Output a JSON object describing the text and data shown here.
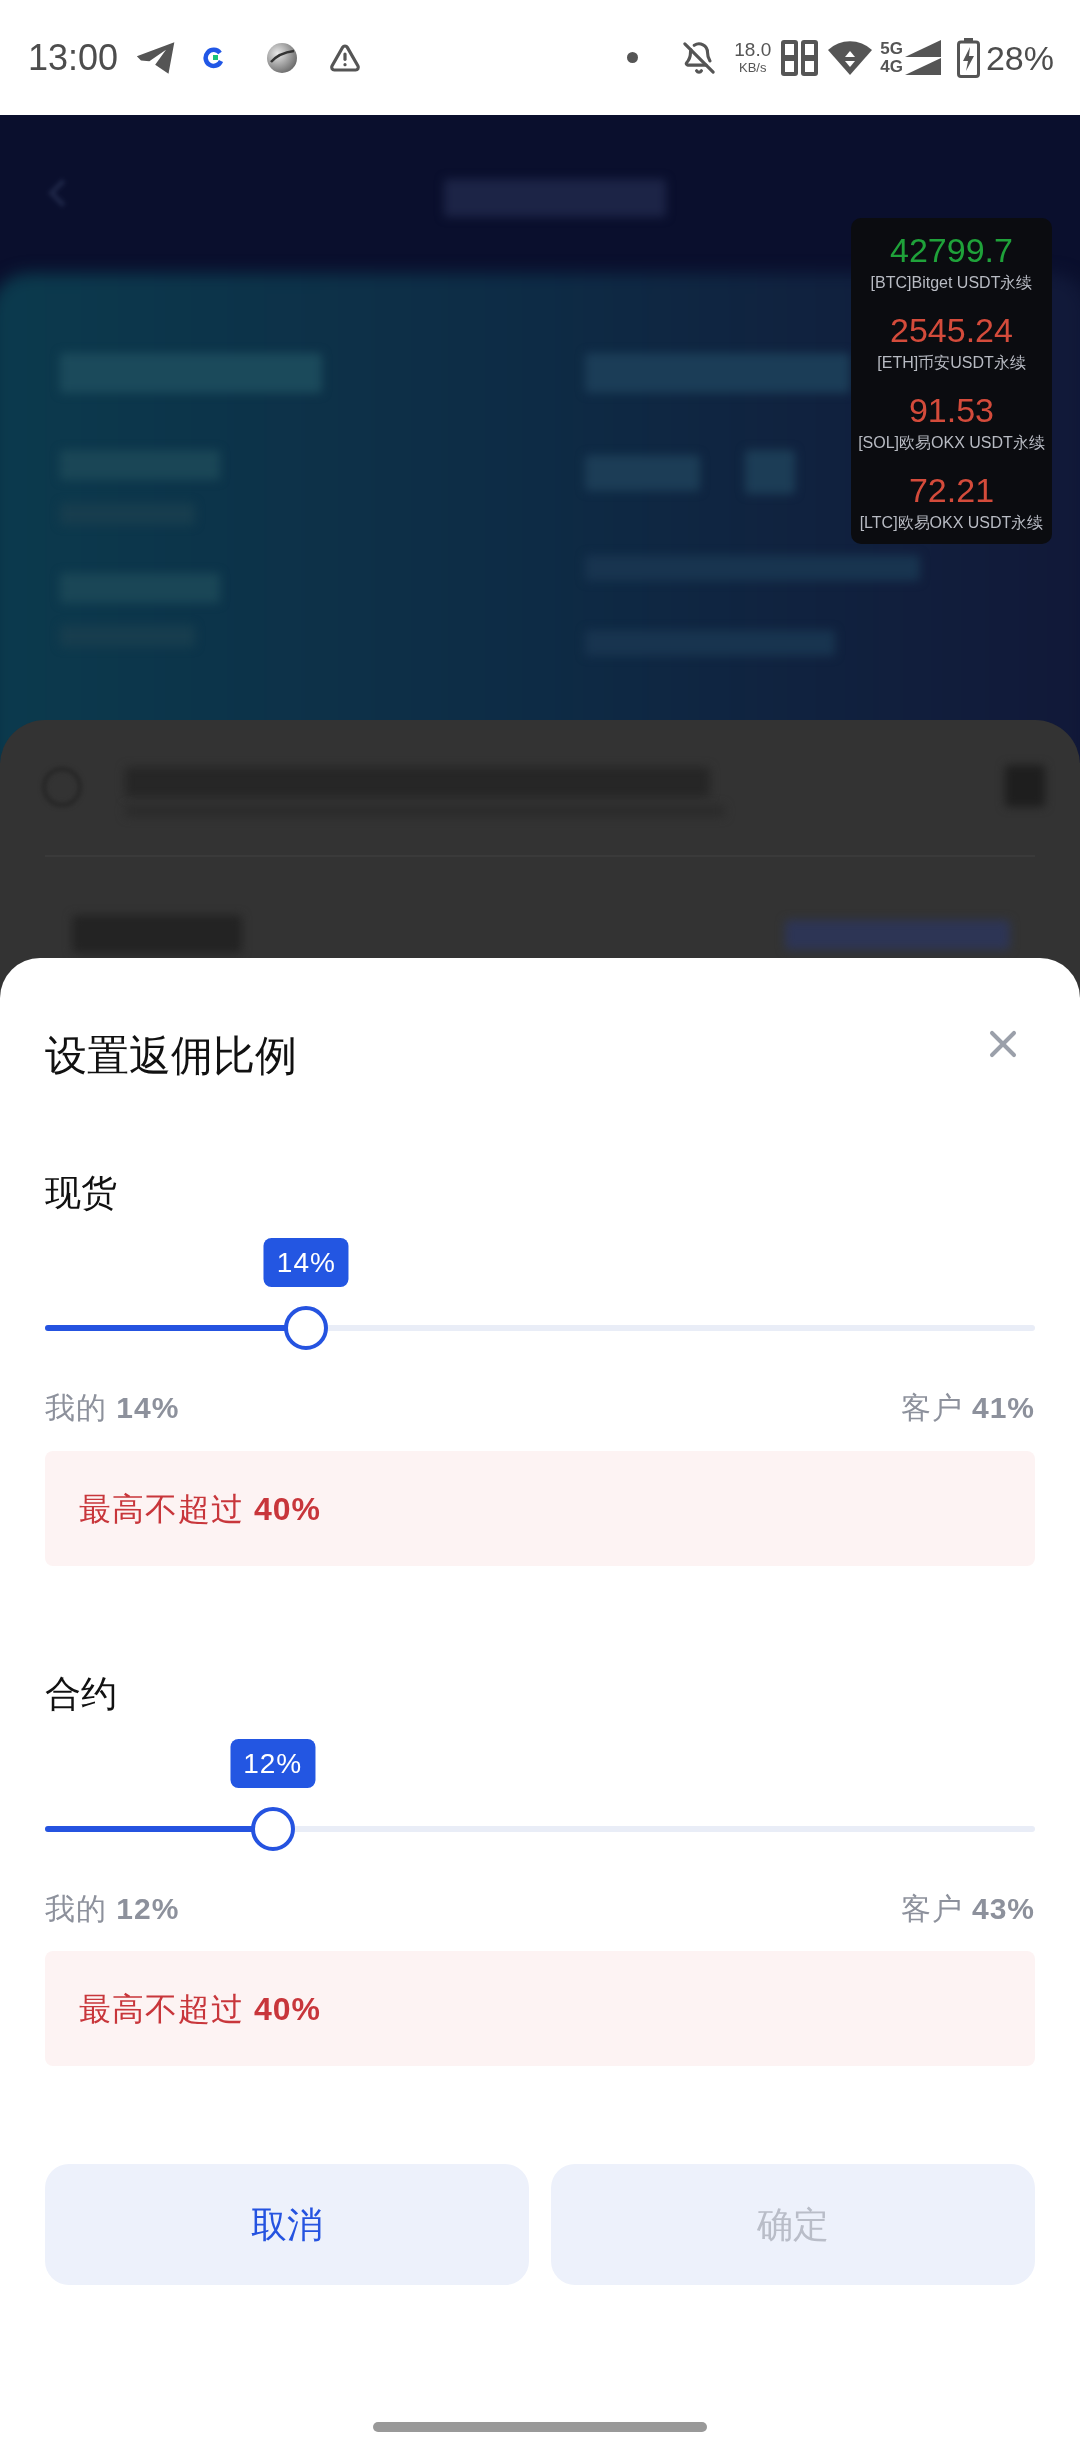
{
  "status_bar": {
    "time": "13:00",
    "speed": "18.0",
    "speed_unit": "KB/s",
    "networks": [
      "5G",
      "4G"
    ],
    "battery": "28%"
  },
  "ticker": [
    {
      "price": "42799.7",
      "label": "[BTC]Bitget USDT永续",
      "color": "#1fa23a"
    },
    {
      "price": "2545.24",
      "label": "[ETH]币安USDT永续",
      "color": "#d44b3b"
    },
    {
      "price": "91.53",
      "label": "[SOL]欧易OKX USDT永续",
      "color": "#d44b3b"
    },
    {
      "price": "72.21",
      "label": "[LTC]欧易OKX USDT永续",
      "color": "#d44b3b"
    }
  ],
  "sheet": {
    "title": "设置返佣比例",
    "sections": [
      {
        "label": "现货",
        "badge": "14%",
        "level": 0.264,
        "mine": "我的 **14%**",
        "client": "客户 **41%**",
        "notice": "最高不超过 **40%**"
      },
      {
        "label": "合约",
        "badge": "12%",
        "level": 0.23,
        "mine": "我的 **12%**",
        "client": "客户 **43%**",
        "notice": "最高不超过 **40%**"
      }
    ],
    "buttons": [
      {
        "label": "取消",
        "disabled": false
      },
      {
        "label": "确定",
        "disabled": true
      }
    ]
  }
}
